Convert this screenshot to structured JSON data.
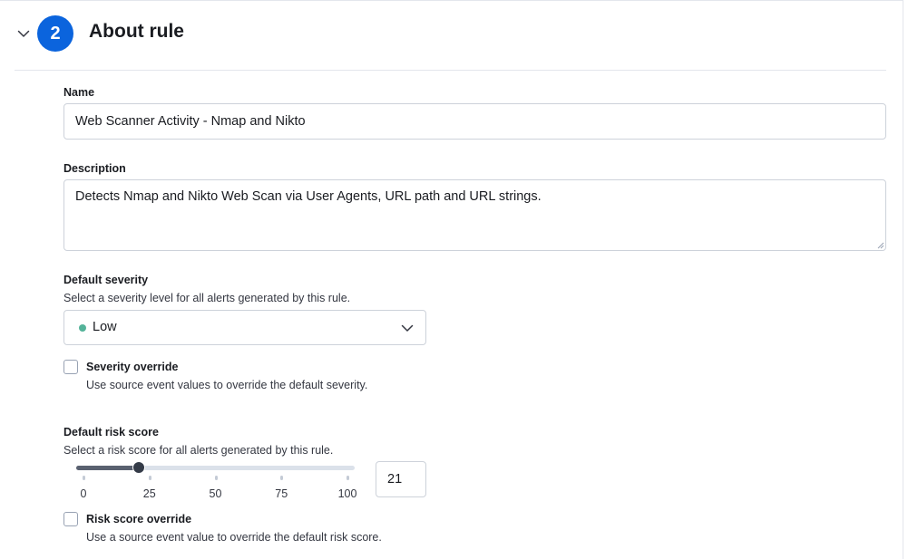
{
  "step": {
    "number": "2",
    "title": "About rule"
  },
  "name_field": {
    "label": "Name",
    "value": "Web Scanner Activity - Nmap and Nikto"
  },
  "description_field": {
    "label": "Description",
    "value": "Detects Nmap and Nikto Web Scan via User Agents, URL path and URL strings."
  },
  "severity": {
    "label": "Default severity",
    "help": "Select a severity level for all alerts generated by this rule.",
    "selected": "Low",
    "dot_color": "#54b399"
  },
  "severity_override": {
    "label": "Severity override",
    "help": "Use source event values to override the default severity.",
    "checked": false
  },
  "risk_score": {
    "label": "Default risk score",
    "help": "Select a risk score for all alerts generated by this rule.",
    "value": 21,
    "value_text": "21",
    "min": 0,
    "max": 100,
    "ticks": [
      "0",
      "25",
      "50",
      "75",
      "100"
    ]
  },
  "risk_override": {
    "label": "Risk score override",
    "help": "Use a source event value to override the default risk score.",
    "checked": false
  },
  "colors": {
    "accent": "#0b64dd",
    "low_severity": "#54b399"
  }
}
